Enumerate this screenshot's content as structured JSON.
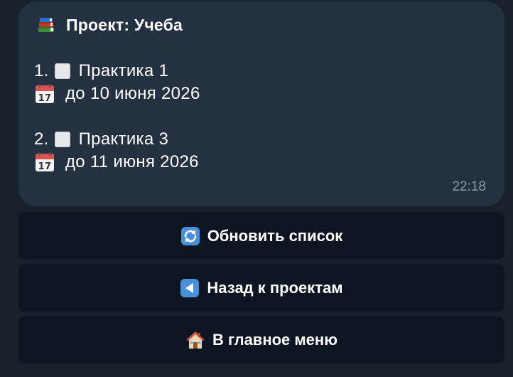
{
  "message": {
    "title_icon": "books-icon",
    "title": "Проект: Учеба",
    "tasks": [
      {
        "number": "1.",
        "status_icon": "checkbox-empty-icon",
        "name": "Практика 1",
        "due_icon": "calendar-icon",
        "due": "до 10 июня 2026"
      },
      {
        "number": "2.",
        "status_icon": "checkbox-empty-icon",
        "name": "Практика 3",
        "due_icon": "calendar-icon",
        "due": "до 11 июня 2026"
      }
    ],
    "time": "22:18"
  },
  "keyboard": {
    "refresh": {
      "icon": "refresh-arrows-icon",
      "label": "Обновить список"
    },
    "back": {
      "icon": "back-arrow-icon",
      "label": "Назад к проектам"
    },
    "home": {
      "icon": "house-icon",
      "label": "В главное меню"
    }
  },
  "colors": {
    "background": "#17212b",
    "bubble": "#243141",
    "button": "#0c1521",
    "timestamp": "#8b98a5"
  }
}
